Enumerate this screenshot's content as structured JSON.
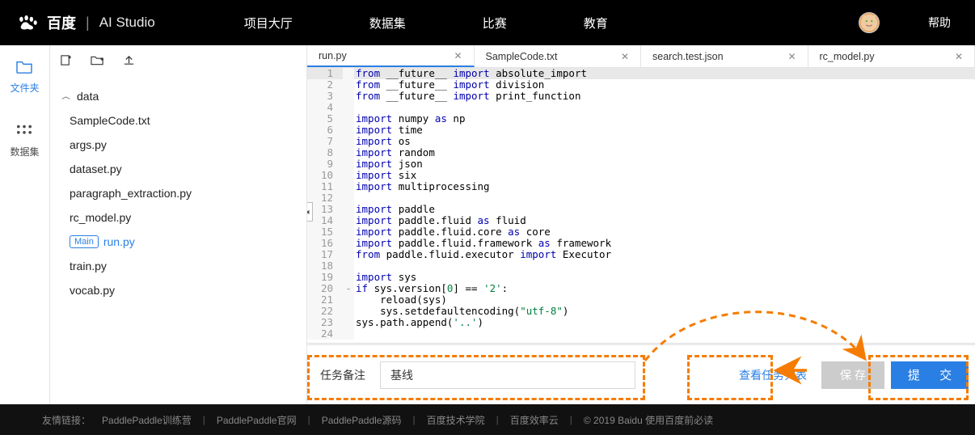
{
  "header": {
    "brand_ch": "百度",
    "brand_en": "AI Studio",
    "nav": [
      "项目大厅",
      "数据集",
      "比赛",
      "教育"
    ],
    "help": "帮助"
  },
  "rail": {
    "files": "文件夹",
    "datasets": "数据集"
  },
  "toolbar_icons": {
    "new": "new-file",
    "new_folder": "new-folder",
    "upload": "upload"
  },
  "tree": {
    "folder": "data",
    "files": [
      "SampleCode.txt",
      "args.py",
      "dataset.py",
      "paragraph_extraction.py",
      "rc_model.py",
      {
        "name": "run.py",
        "main": true,
        "active": true
      },
      "train.py",
      "vocab.py"
    ],
    "main_badge": "Main"
  },
  "tabs": [
    {
      "label": "run.py",
      "active": true
    },
    {
      "label": "SampleCode.txt"
    },
    {
      "label": "search.test.json"
    },
    {
      "label": "rc_model.py"
    }
  ],
  "bottom": {
    "note_label": "任务备注",
    "note_value": "基线",
    "view_tasks": "查看任务列表",
    "save": "保 存",
    "submit": "提 交"
  },
  "footer": {
    "prefix": "友情链接：",
    "links": [
      "PaddlePaddle训练营",
      "PaddlePaddle官网",
      "PaddlePaddle源码",
      "百度技术学院",
      "百度效率云"
    ],
    "copyright": "© 2019 Baidu 使用百度前必读"
  },
  "code": [
    {
      "n": 1,
      "t": [
        [
          "kw",
          "from "
        ],
        [
          "id",
          "__future__ "
        ],
        [
          "kw",
          "import "
        ],
        [
          "id",
          "absolute_import"
        ]
      ],
      "hl": true
    },
    {
      "n": 2,
      "t": [
        [
          "kw",
          "from "
        ],
        [
          "id",
          "__future__ "
        ],
        [
          "kw",
          "import "
        ],
        [
          "id",
          "division"
        ]
      ]
    },
    {
      "n": 3,
      "t": [
        [
          "kw",
          "from "
        ],
        [
          "id",
          "__future__ "
        ],
        [
          "kw",
          "import "
        ],
        [
          "id",
          "print_function"
        ]
      ]
    },
    {
      "n": 4,
      "t": []
    },
    {
      "n": 5,
      "t": [
        [
          "kw",
          "import "
        ],
        [
          "id",
          "numpy "
        ],
        [
          "as",
          "as "
        ],
        [
          "id",
          "np"
        ]
      ]
    },
    {
      "n": 6,
      "t": [
        [
          "kw",
          "import "
        ],
        [
          "id",
          "time"
        ]
      ]
    },
    {
      "n": 7,
      "t": [
        [
          "kw",
          "import "
        ],
        [
          "id",
          "os"
        ]
      ]
    },
    {
      "n": 8,
      "t": [
        [
          "kw",
          "import "
        ],
        [
          "id",
          "random"
        ]
      ]
    },
    {
      "n": 9,
      "t": [
        [
          "kw",
          "import "
        ],
        [
          "id",
          "json"
        ]
      ]
    },
    {
      "n": 10,
      "t": [
        [
          "kw",
          "import "
        ],
        [
          "id",
          "six"
        ]
      ]
    },
    {
      "n": 11,
      "t": [
        [
          "kw",
          "import "
        ],
        [
          "id",
          "multiprocessing"
        ]
      ]
    },
    {
      "n": 12,
      "t": []
    },
    {
      "n": 13,
      "t": [
        [
          "kw",
          "import "
        ],
        [
          "id",
          "paddle"
        ]
      ]
    },
    {
      "n": 14,
      "t": [
        [
          "kw",
          "import "
        ],
        [
          "id",
          "paddle.fluid "
        ],
        [
          "as",
          "as "
        ],
        [
          "id",
          "fluid"
        ]
      ]
    },
    {
      "n": 15,
      "t": [
        [
          "kw",
          "import "
        ],
        [
          "id",
          "paddle.fluid.core "
        ],
        [
          "as",
          "as "
        ],
        [
          "id",
          "core"
        ]
      ]
    },
    {
      "n": 16,
      "t": [
        [
          "kw",
          "import "
        ],
        [
          "id",
          "paddle.fluid.framework "
        ],
        [
          "as",
          "as "
        ],
        [
          "id",
          "framework"
        ]
      ]
    },
    {
      "n": 17,
      "t": [
        [
          "kw",
          "from "
        ],
        [
          "id",
          "paddle.fluid.executor "
        ],
        [
          "kw",
          "import "
        ],
        [
          "id",
          "Executor"
        ]
      ]
    },
    {
      "n": 18,
      "t": []
    },
    {
      "n": 19,
      "t": [
        [
          "kw",
          "import "
        ],
        [
          "id",
          "sys"
        ]
      ]
    },
    {
      "n": 20,
      "t": [
        [
          "kw",
          "if "
        ],
        [
          "id",
          "sys.version["
        ],
        [
          "num",
          "0"
        ],
        [
          "id",
          "] == "
        ],
        [
          "str",
          "'2'"
        ],
        [
          "id",
          ":"
        ]
      ],
      "fold": "-"
    },
    {
      "n": 21,
      "t": [
        [
          "id",
          "    reload(sys)"
        ]
      ]
    },
    {
      "n": 22,
      "t": [
        [
          "id",
          "    sys.setdefaultencoding("
        ],
        [
          "str",
          "\"utf-8\""
        ],
        [
          "id",
          ")"
        ]
      ]
    },
    {
      "n": 23,
      "t": [
        [
          "id",
          "sys.path.append("
        ],
        [
          "str",
          "'..'"
        ],
        [
          "id",
          ")"
        ]
      ]
    },
    {
      "n": 24,
      "t": []
    }
  ]
}
